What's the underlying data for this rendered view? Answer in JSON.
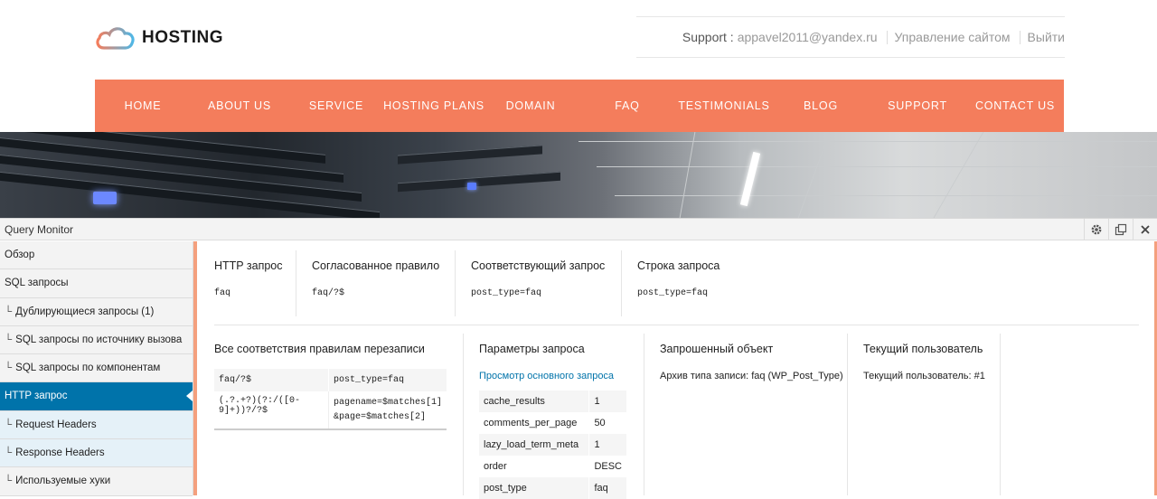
{
  "site": {
    "logo_text": "HOSTING",
    "support_label": "Support :",
    "support_email": "appavel2011@yandex.ru",
    "manage_link": "Управление сайтом",
    "logout_link": "Выйти"
  },
  "nav": {
    "items": [
      "HOME",
      "ABOUT US",
      "SERVICE",
      "HOSTING PLANS",
      "DOMAIN",
      "FAQ",
      "TESTIMONIALS",
      "BLOG",
      "SUPPORT",
      "CONTACT US"
    ]
  },
  "colors": {
    "nav_bg": "#f47d5c",
    "qm_active": "#0073aa",
    "qm_accent": "#f4a07e"
  },
  "qm": {
    "title": "Query Monitor",
    "controls": [
      "gear-icon",
      "popout-icon",
      "close-icon"
    ],
    "sidebar": [
      {
        "label": "Обзор",
        "prefix": ""
      },
      {
        "label": "SQL запросы",
        "prefix": ""
      },
      {
        "label": "Дублирующиеся запросы (1)",
        "prefix": "└"
      },
      {
        "label": "SQL запросы по источнику вызова",
        "prefix": "└"
      },
      {
        "label": "SQL запросы по компонентам",
        "prefix": "└"
      },
      {
        "label": "HTTP запрос",
        "prefix": ""
      },
      {
        "label": "Request Headers",
        "prefix": "└"
      },
      {
        "label": "Response Headers",
        "prefix": "└"
      },
      {
        "label": "Используемые хуки",
        "prefix": "└"
      }
    ],
    "top_sections": [
      {
        "heading": "HTTP запрос",
        "value": "faq"
      },
      {
        "heading": "Согласованное правило",
        "value": "faq/?$"
      },
      {
        "heading": "Соответствующий запрос",
        "value": "post_type=faq"
      },
      {
        "heading": "Строка запроса",
        "value": "post_type=faq"
      }
    ],
    "rewrite": {
      "heading": "Все соответствия правилам перезаписи",
      "rows": [
        {
          "rule": "faq/?$",
          "query": "post_type=faq",
          "query2": ""
        },
        {
          "rule": "(.?.+?)(?:/([0-9]+))?/?$",
          "query": "pagename=$matches[1]",
          "query2": "&page=$matches[2]"
        }
      ]
    },
    "params": {
      "heading": "Параметры запроса",
      "link": "Просмотр основного запроса",
      "rows": [
        {
          "name": "cache_results",
          "value": "1"
        },
        {
          "name": "comments_per_page",
          "value": "50"
        },
        {
          "name": "lazy_load_term_meta",
          "value": "1"
        },
        {
          "name": "order",
          "value": "DESC"
        },
        {
          "name": "post_type",
          "value": "faq"
        }
      ]
    },
    "queried_object": {
      "heading": "Запрошенный объект",
      "value": "Архив типа записи: faq (WP_Post_Type)"
    },
    "current_user": {
      "heading": "Текущий пользователь",
      "value": "Текущий пользователь: #1"
    }
  }
}
